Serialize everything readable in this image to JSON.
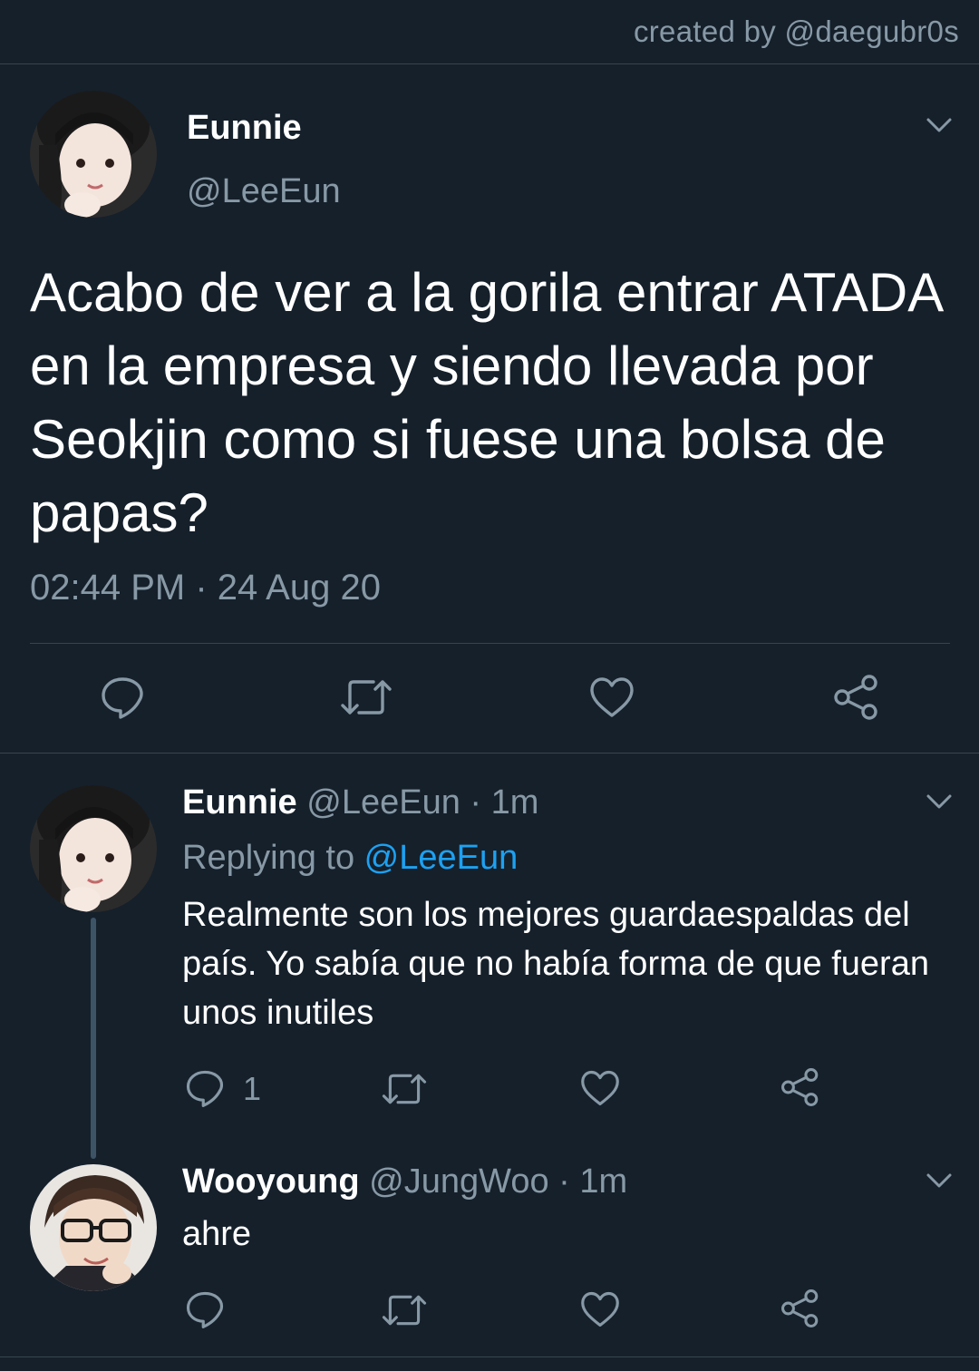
{
  "header": {
    "credit": "created by @daegubr0s"
  },
  "main_tweet": {
    "name": "Eunnie",
    "handle": "@LeeEun",
    "text": "Acabo de ver a la gorila entrar ATADA en la empresa y siendo llevada por Seokjin como si fuese una bolsa de papas?",
    "timestamp": "02:44 PM · 24 Aug 20",
    "actions": [
      "reply-icon",
      "retweet-icon",
      "like-icon",
      "share-icon"
    ]
  },
  "replies": [
    {
      "name": "Eunnie",
      "handle": "@LeeEun",
      "sep": " · ",
      "time": "1m",
      "replying_prefix": "Replying to ",
      "replying_to": "@LeeEun",
      "text": "Realmente son los mejores guardaespaldas del país. Yo sabía que no había forma de que fueran unos inutiles",
      "reply_count": "1"
    },
    {
      "name": "Wooyoung",
      "handle": "@JungWoo",
      "sep": " · ",
      "time": "1m",
      "text": "ahre"
    }
  ],
  "colors": {
    "background": "#15202b",
    "secondary_text": "#8899a6",
    "link": "#1da1f2",
    "divider": "#38444d"
  }
}
